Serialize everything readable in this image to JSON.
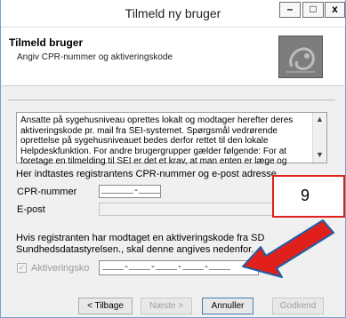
{
  "window": {
    "title": "Tilmeld ny bruger",
    "min_glyph": "–",
    "max_glyph": "□",
    "close_glyph": "x"
  },
  "header": {
    "title": "Tilmeld bruger",
    "subtitle": "Angiv CPR-nummer og aktiveringskode"
  },
  "info": {
    "lines": [
      "Ansatte på sygehusniveau oprettes lokalt og modtager herefter deres",
      "aktiveringskode pr. mail fra SEI-systemet. Spørgsmål vedrørende",
      "oprettelse på sygehusniveauet bedes derfor rettet til den lokale",
      "Helpdeskfunktion. For andre brugergrupper gælder følgende: For at",
      "foretage en tilmelding til SEI er det et krav, at man enten er læge og"
    ]
  },
  "form": {
    "intro": "Her indtastes registrantens CPR-nummer og e-post adresse.",
    "cpr_label": "CPR-nummer",
    "cpr_value": "______-____",
    "email_label": "E-post",
    "activation_text_1": "Hvis registranten har modtaget en aktiveringskode fra SD",
    "activation_text_2": "Sundhedsdatastyrelsen., skal denne angives nedenfor.",
    "activation_label": "Aktiveringsko",
    "activation_value": "____-____-____-____-____",
    "checkbox_mark": "✓"
  },
  "buttons": {
    "back": "< Tilbage",
    "next": "Næste >",
    "cancel": "Annuller",
    "approve": "Godkend"
  },
  "annotation": {
    "number": "9",
    "color": "#e0201a"
  }
}
